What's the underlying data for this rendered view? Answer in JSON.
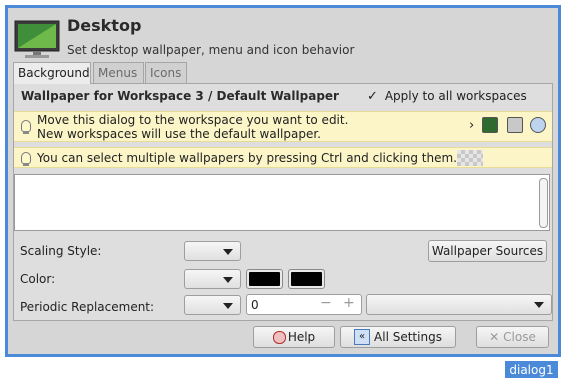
{
  "window": {
    "title": "Desktop",
    "subtitle": "Set desktop wallpaper, menu and icon behavior",
    "tag": "dialog1"
  },
  "tabs": [
    {
      "label": "Background",
      "active": true
    },
    {
      "label": "Menus",
      "active": false
    },
    {
      "label": "Icons",
      "active": false
    }
  ],
  "background": {
    "header_title": "Wallpaper for Workspace 3 / Default Wallpaper",
    "apply_all_label": "Apply to all workspaces",
    "apply_all_checked": true,
    "info1_line1": "Move this dialog to the workspace you want to edit.",
    "info1_line2": "New workspaces will use the default wallpaper.",
    "info2": "You can select multiple wallpapers by pressing Ctrl and clicking them.",
    "scaling_label": "Scaling Style:",
    "wallpaper_sources_label": "Wallpaper Sources",
    "color_label": "Color:",
    "color1": "#000000",
    "color2": "#000000",
    "periodic_label": "Periodic Replacement:",
    "periodic_value": "0"
  },
  "buttons": {
    "help": "Help",
    "all_settings": "All Settings",
    "close": "Close"
  },
  "colors": {
    "window_border": "#4a8ad8",
    "info_bg": "#fbf5c8"
  }
}
